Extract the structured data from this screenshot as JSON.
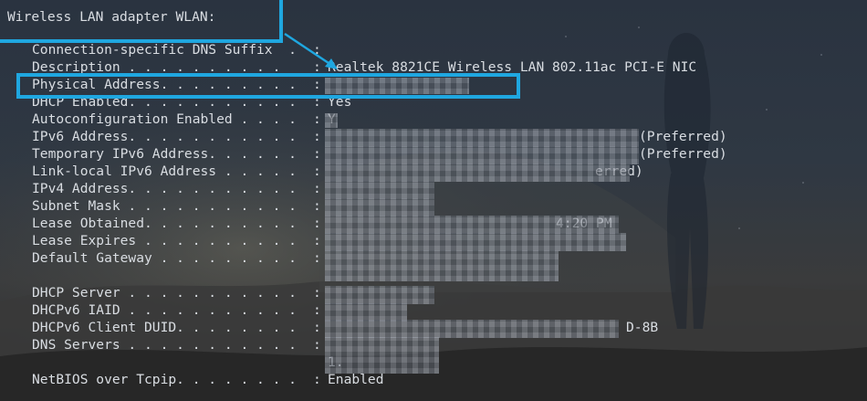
{
  "terminal": {
    "header": "Wireless LAN adapter WLAN:",
    "rows": [
      {
        "label": "Connection-specific DNS Suffix  .",
        "colon": ":",
        "value": ""
      },
      {
        "label": "Description . . . . . . . . . .",
        "colon": ":",
        "value": "Realtek 8821CE Wireless LAN 802.11ac PCI-E NIC"
      },
      {
        "label": "Physical Address. . . . . . . . .",
        "colon": ":",
        "value": ""
      },
      {
        "label": "DHCP Enabled. . . . . . . . . . .",
        "colon": ":",
        "value": "Yes"
      },
      {
        "label": "Autoconfiguration Enabled . . . .",
        "colon": ":",
        "value": "Y"
      },
      {
        "label": "IPv6 Address. . . . . . . . . . .",
        "colon": ":",
        "value": "(Preferred)"
      },
      {
        "label": "Temporary IPv6 Address. . . . . .",
        "colon": ":",
        "value": "(Preferred)"
      },
      {
        "label": "Link-local IPv6 Address . . . . .",
        "colon": ":",
        "value": "erred)"
      },
      {
        "label": "IPv4 Address. . . . . . . . . . .",
        "colon": ":",
        "value": ""
      },
      {
        "label": "Subnet Mask . . . . . . . . . . .",
        "colon": ":",
        "value": ""
      },
      {
        "label": "Lease Obtained. . . . . . . . . .",
        "colon": ":",
        "value": "4:20 PM"
      },
      {
        "label": "Lease Expires . . . . . . . . . .",
        "colon": ":",
        "value": ""
      },
      {
        "label": "Default Gateway . . . . . . . . .",
        "colon": ":",
        "value": ""
      },
      {
        "label": "",
        "colon": "",
        "value": ""
      },
      {
        "label": "DHCP Server . . . . . . . . . . .",
        "colon": ":",
        "value": ""
      },
      {
        "label": "DHCPv6 IAID . . . . . . . . . . .",
        "colon": ":",
        "value": ""
      },
      {
        "label": "DHCPv6 Client DUID. . . . . . . .",
        "colon": ":",
        "value": "D-8B"
      },
      {
        "label": "DNS Servers . . . . . . . . . . .",
        "colon": ":",
        "value": ""
      },
      {
        "label": "",
        "colon": "",
        "value": "1."
      },
      {
        "label": "NetBIOS over Tcpip. . . . . . . .",
        "colon": ":",
        "value": "Enabled"
      }
    ]
  }
}
